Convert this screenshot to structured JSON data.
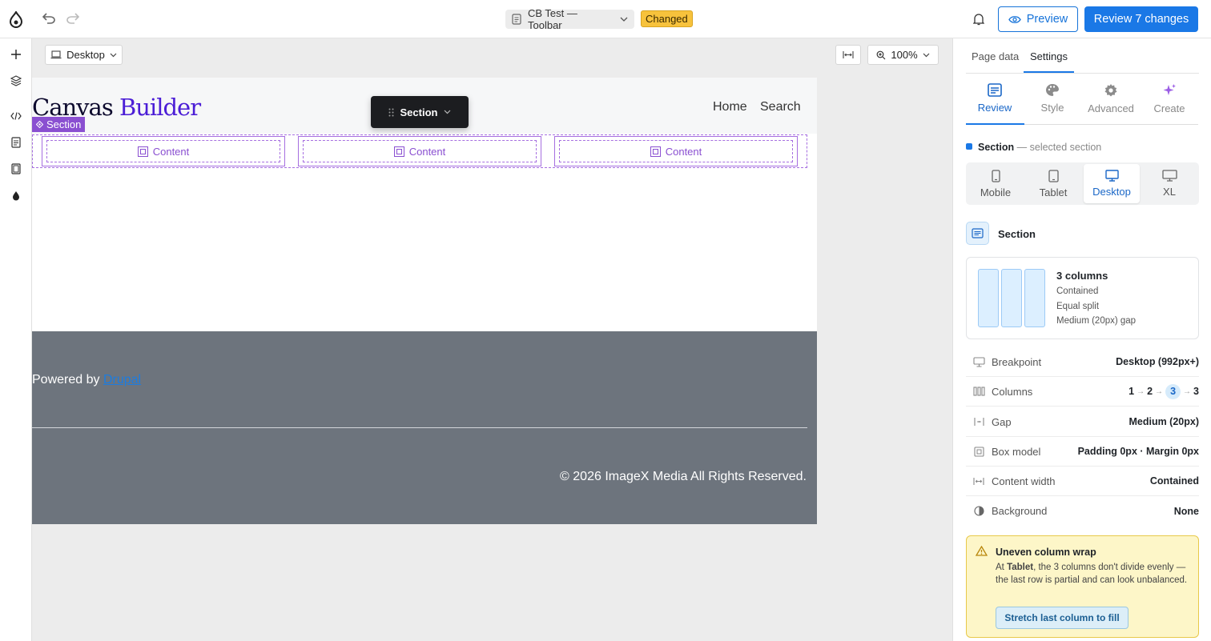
{
  "topbar": {
    "document_title": "CB Test — Toolbar",
    "status_badge": "Changed",
    "preview_label": "Preview",
    "review_label": "Review 7 changes"
  },
  "canvas": {
    "viewport_label": "Desktop",
    "zoom": "100%"
  },
  "page": {
    "logo_part1": "Canvas",
    "logo_part2": "Builder",
    "nav": [
      "Home",
      "Search"
    ],
    "section_tag": "Section",
    "columns": [
      "Content",
      "Content",
      "Content"
    ],
    "footer_powered": "Powered by ",
    "footer_link": "Drupal",
    "footer_copy": "© 2026 ImageX Media All Rights Reserved."
  },
  "floating_toolbar": {
    "label": "Section"
  },
  "panel": {
    "tabs": [
      "Page data",
      "Settings"
    ],
    "active_tab": "Settings",
    "view_tabs": [
      "Review",
      "Style",
      "Advanced",
      "Create"
    ],
    "selected_name": "Section",
    "selected_suffix": "— selected section",
    "breakpoints": [
      "Mobile",
      "Tablet",
      "Desktop",
      "XL"
    ],
    "component_title": "Section",
    "layout_card": {
      "title": "3 columns",
      "lines": [
        "Contained",
        "Equal split",
        "Medium (20px) gap"
      ]
    },
    "props": {
      "breakpoint": {
        "label": "Breakpoint",
        "value": "Desktop (992px+)"
      },
      "columns": {
        "label": "Columns",
        "steps": [
          "1",
          "2",
          "3",
          "3"
        ]
      },
      "gap": {
        "label": "Gap",
        "value": "Medium (20px)"
      },
      "box_model": {
        "label": "Box model",
        "value": "Padding 0px · Margin 0px"
      },
      "content_width": {
        "label": "Content width",
        "value": "Contained"
      },
      "background": {
        "label": "Background",
        "value": "None"
      }
    },
    "warning": {
      "title": "Uneven column wrap",
      "body_pre": "At ",
      "body_bold": "Tablet",
      "body_post": ", the 3 columns don't divide evenly — the last row is partial and can look unbalanced.",
      "action": "Stretch last column to fill"
    }
  },
  "colors": {
    "accent": "#1a78e6",
    "section_purple": "#8a4fd1",
    "badge_yellow": "#f7c23c",
    "footer_gray": "#6d747d"
  }
}
